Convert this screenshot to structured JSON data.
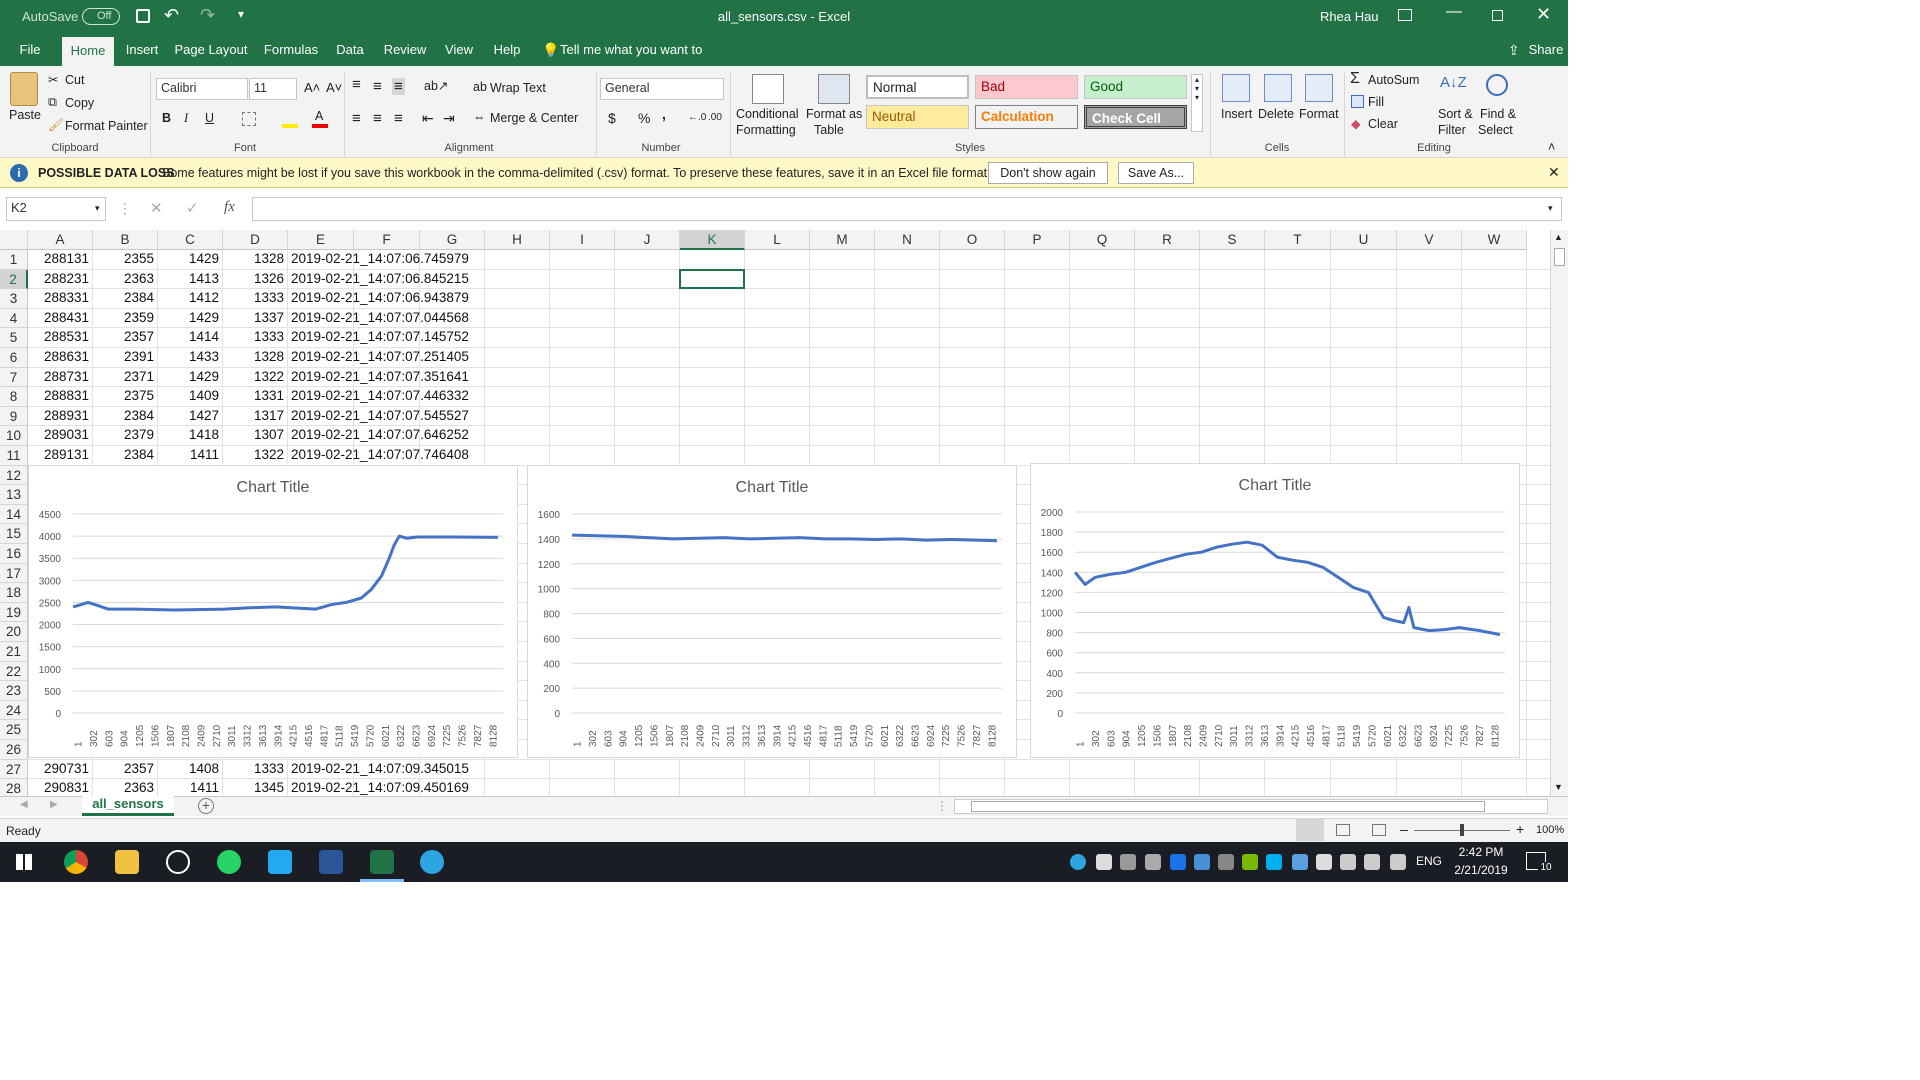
{
  "titlebar": {
    "autosave_label": "AutoSave",
    "autosave_state": "Off",
    "title": "all_sensors.csv  -  Excel",
    "user": "Rhea Hau"
  },
  "tabs": [
    "File",
    "Home",
    "Insert",
    "Page Layout",
    "Formulas",
    "Data",
    "Review",
    "View",
    "Help"
  ],
  "active_tab": "Home",
  "tell_me": "Tell me what you want to do",
  "share": "Share",
  "ribbon": {
    "clipboard": {
      "paste": "Paste",
      "cut": "Cut",
      "copy": "Copy",
      "format_painter": "Format Painter",
      "label": "Clipboard"
    },
    "font": {
      "name": "Calibri",
      "size": "11",
      "bold": "B",
      "italic": "I",
      "underline": "U",
      "label": "Font"
    },
    "alignment": {
      "wrap": "Wrap Text",
      "merge": "Merge & Center",
      "label": "Alignment"
    },
    "number": {
      "format": "General",
      "currency": "$",
      "percent": "%",
      "comma": ",",
      "label": "Number"
    },
    "styles": {
      "conditional": "Conditional",
      "conditional2": "Formatting",
      "format_as": "Format as",
      "format_as2": "Table",
      "normal": "Normal",
      "bad": "Bad",
      "good": "Good",
      "neutral": "Neutral",
      "calculation": "Calculation",
      "check_cell": "Check Cell",
      "label": "Styles"
    },
    "cells": {
      "insert": "Insert",
      "delete": "Delete",
      "format": "Format",
      "label": "Cells"
    },
    "editing": {
      "autosum": "AutoSum",
      "fill": "Fill",
      "clear": "Clear",
      "sort": "Sort &",
      "sort2": "Filter",
      "find": "Find &",
      "find2": "Select",
      "label": "Editing"
    }
  },
  "infobar": {
    "title": "POSSIBLE DATA LOSS",
    "message": "Some features might be lost if you save this workbook in the comma-delimited (.csv) format. To preserve these features, save it in an Excel file format.",
    "dont_show": "Don't show again",
    "save_as": "Save As..."
  },
  "formula": {
    "namebox": "K2",
    "fx": "fx",
    "value": ""
  },
  "columns": [
    "A",
    "B",
    "C",
    "D",
    "E",
    "F",
    "G",
    "H",
    "I",
    "J",
    "K",
    "L",
    "M",
    "N",
    "O",
    "P",
    "Q",
    "R",
    "S",
    "T",
    "U",
    "V",
    "W"
  ],
  "selected_column": "K",
  "rows": [
    {
      "n": "1",
      "a": "288131",
      "b": "2355",
      "c": "1429",
      "d": "1328",
      "e": "2019-02-21_14:07:06.745979"
    },
    {
      "n": "2",
      "a": "288231",
      "b": "2363",
      "c": "1413",
      "d": "1326",
      "e": "2019-02-21_14:07:06.845215"
    },
    {
      "n": "3",
      "a": "288331",
      "b": "2384",
      "c": "1412",
      "d": "1333",
      "e": "2019-02-21_14:07:06.943879"
    },
    {
      "n": "4",
      "a": "288431",
      "b": "2359",
      "c": "1429",
      "d": "1337",
      "e": "2019-02-21_14:07:07.044568"
    },
    {
      "n": "5",
      "a": "288531",
      "b": "2357",
      "c": "1414",
      "d": "1333",
      "e": "2019-02-21_14:07:07.145752"
    },
    {
      "n": "6",
      "a": "288631",
      "b": "2391",
      "c": "1433",
      "d": "1328",
      "e": "2019-02-21_14:07:07.251405"
    },
    {
      "n": "7",
      "a": "288731",
      "b": "2371",
      "c": "1429",
      "d": "1322",
      "e": "2019-02-21_14:07:07.351641"
    },
    {
      "n": "8",
      "a": "288831",
      "b": "2375",
      "c": "1409",
      "d": "1331",
      "e": "2019-02-21_14:07:07.446332"
    },
    {
      "n": "9",
      "a": "288931",
      "b": "2384",
      "c": "1427",
      "d": "1317",
      "e": "2019-02-21_14:07:07.545527"
    },
    {
      "n": "10",
      "a": "289031",
      "b": "2379",
      "c": "1418",
      "d": "1307",
      "e": "2019-02-21_14:07:07.646252"
    },
    {
      "n": "11",
      "a": "289131",
      "b": "2384",
      "c": "1411",
      "d": "1322",
      "e": "2019-02-21_14:07:07.746408"
    },
    {
      "n": "12"
    },
    {
      "n": "13"
    },
    {
      "n": "14"
    },
    {
      "n": "15"
    },
    {
      "n": "16"
    },
    {
      "n": "17"
    },
    {
      "n": "18"
    },
    {
      "n": "19"
    },
    {
      "n": "20"
    },
    {
      "n": "21"
    },
    {
      "n": "22"
    },
    {
      "n": "23"
    },
    {
      "n": "24"
    },
    {
      "n": "25"
    },
    {
      "n": "26"
    },
    {
      "n": "27",
      "a": "290731",
      "b": "2357",
      "c": "1408",
      "d": "1333",
      "e": "2019-02-21_14:07:09.345015"
    },
    {
      "n": "28",
      "a": "290831",
      "b": "2363",
      "c": "1411",
      "d": "1345",
      "e": "2019-02-21_14:07:09.450169"
    }
  ],
  "sheet_tab": "all_sensors",
  "status": {
    "ready": "Ready",
    "zoom": "100%"
  },
  "taskbar": {
    "time": "2:42 PM",
    "date": "2/21/2019",
    "lang": "ENG",
    "notif_count": "10"
  },
  "chart_data": [
    {
      "type": "line",
      "title": "Chart Title",
      "ylim": [
        0,
        4500
      ],
      "yticks": [
        "4500",
        "4000",
        "3500",
        "3000",
        "2500",
        "2000",
        "1500",
        "1000",
        "500",
        "0"
      ],
      "xticks": [
        "1",
        "302",
        "603",
        "904",
        "1205",
        "1506",
        "1807",
        "2108",
        "2409",
        "2710",
        "3011",
        "3312",
        "3613",
        "3914",
        "4215",
        "4516",
        "4817",
        "5118",
        "5419",
        "5720",
        "6021",
        "6322",
        "6623",
        "6924",
        "7225",
        "7526",
        "7827",
        "8128"
      ],
      "series": [
        {
          "x": [
            1,
            300,
            700,
            1200,
            2000,
            3000,
            3500,
            4000,
            4800,
            5100,
            5400,
            5700,
            5900,
            6100,
            6250,
            6350,
            6450,
            6600,
            6800,
            7500,
            8400
          ],
          "y": [
            2400,
            2500,
            2350,
            2350,
            2330,
            2350,
            2380,
            2400,
            2350,
            2450,
            2500,
            2600,
            2800,
            3100,
            3500,
            3800,
            4000,
            3950,
            3980,
            3980,
            3970
          ]
        }
      ],
      "color": "#4472c4"
    },
    {
      "type": "line",
      "title": "Chart Title",
      "ylim": [
        0,
        1600
      ],
      "yticks": [
        "1600",
        "1400",
        "1200",
        "1000",
        "800",
        "600",
        "400",
        "200",
        "0"
      ],
      "xticks": [
        "1",
        "302",
        "603",
        "904",
        "1205",
        "1506",
        "1807",
        "2108",
        "2409",
        "2710",
        "3011",
        "3312",
        "3613",
        "3914",
        "4215",
        "4516",
        "4817",
        "5118",
        "5419",
        "5720",
        "6021",
        "6322",
        "6623",
        "6924",
        "7225",
        "7526",
        "7827",
        "8128"
      ],
      "series": [
        {
          "x": [
            1,
            500,
            1000,
            1500,
            2000,
            2500,
            3000,
            3500,
            4000,
            4500,
            5000,
            5500,
            6000,
            6500,
            7000,
            7500,
            8000,
            8400
          ],
          "y": [
            1430,
            1425,
            1420,
            1410,
            1400,
            1405,
            1410,
            1400,
            1405,
            1410,
            1400,
            1400,
            1395,
            1400,
            1390,
            1395,
            1390,
            1385
          ]
        }
      ],
      "color": "#4472c4"
    },
    {
      "type": "line",
      "title": "Chart Title",
      "ylim": [
        0,
        2000
      ],
      "yticks": [
        "2000",
        "1800",
        "1600",
        "1400",
        "1200",
        "1000",
        "800",
        "600",
        "400",
        "200",
        "0"
      ],
      "xticks": [
        "1",
        "302",
        "603",
        "904",
        "1205",
        "1506",
        "1807",
        "2108",
        "2409",
        "2710",
        "3011",
        "3312",
        "3613",
        "3914",
        "4215",
        "4516",
        "4817",
        "5118",
        "5419",
        "5720",
        "6021",
        "6322",
        "6623",
        "6924",
        "7225",
        "7526",
        "7827",
        "8128"
      ],
      "series": [
        {
          "x": [
            1,
            200,
            400,
            700,
            1000,
            1300,
            1600,
            1900,
            2200,
            2500,
            2800,
            3100,
            3400,
            3700,
            4000,
            4300,
            4600,
            4900,
            5200,
            5500,
            5800,
            6100,
            6300,
            6500,
            6600,
            6700,
            7000,
            7300,
            7600,
            8000,
            8400
          ],
          "y": [
            1400,
            1280,
            1350,
            1380,
            1400,
            1450,
            1500,
            1540,
            1580,
            1600,
            1650,
            1680,
            1700,
            1670,
            1550,
            1520,
            1500,
            1450,
            1350,
            1250,
            1200,
            950,
            920,
            900,
            1050,
            850,
            820,
            830,
            850,
            820,
            780
          ]
        }
      ],
      "color": "#4472c4"
    }
  ]
}
